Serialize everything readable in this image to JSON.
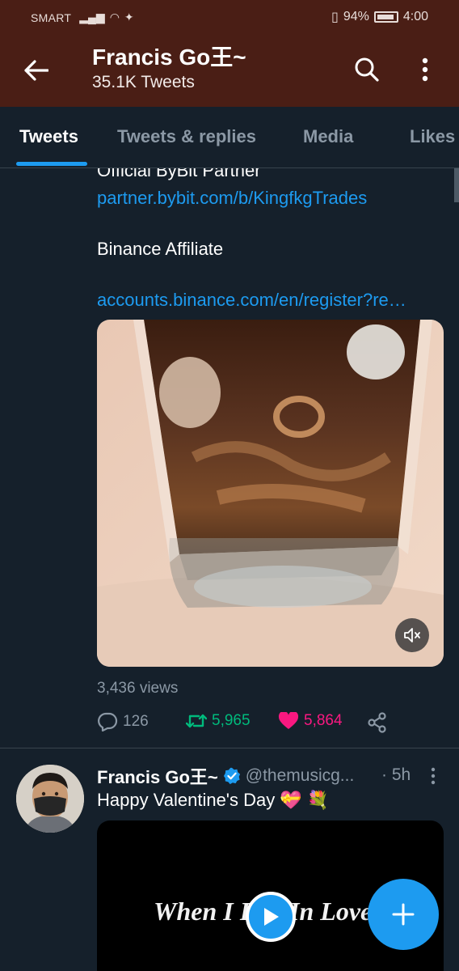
{
  "status_bar": {
    "carrier": "SMART",
    "battery": "94%",
    "time": "4:00"
  },
  "header": {
    "title": "Francis Go王~",
    "subtitle": "35.1K Tweets"
  },
  "tabs": [
    {
      "label": "Tweets",
      "active": true
    },
    {
      "label": "Tweets & replies",
      "active": false
    },
    {
      "label": "Media",
      "active": false
    },
    {
      "label": "Likes",
      "active": false
    }
  ],
  "pinned_tweet": {
    "lines": [
      {
        "text": "Official ByBit Partner",
        "is_link": false
      },
      {
        "text": "partner.bybit.com/b/KingfkgTrades",
        "is_link": true
      },
      {
        "text": "Binance Affiliate",
        "is_link": false
      },
      {
        "text": "accounts.binance.com/en/register?re…",
        "is_link": true
      }
    ],
    "views": "3,436 views",
    "replies": "126",
    "retweets": "5,965",
    "likes": "5,864"
  },
  "second_tweet": {
    "author": "Francis Go王~",
    "handle": "@themusicg...",
    "time": "· 5h",
    "text": "Happy Valentine's Day 💝 💐",
    "video_title": "When I Fell In Love"
  },
  "colors": {
    "header_bg": "#4a1e15",
    "background": "#15202b",
    "accent": "#1d9bf0",
    "retweet": "#00ba7c",
    "like": "#f91880",
    "muted": "#8b98a5"
  }
}
